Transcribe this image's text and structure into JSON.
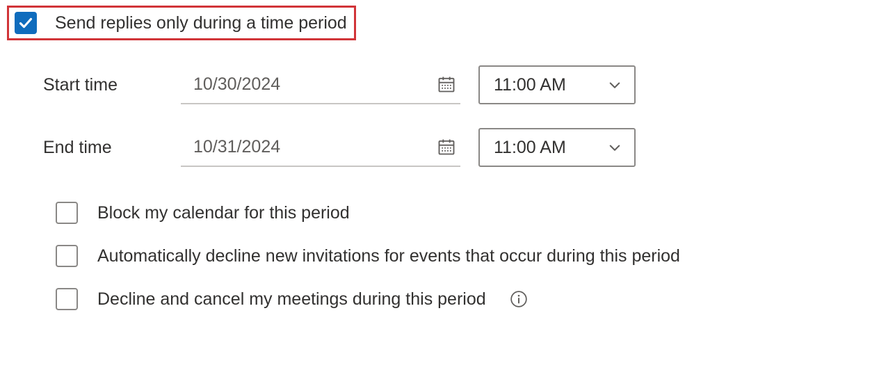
{
  "main": {
    "send_replies_label": "Send replies only during a time period",
    "send_replies_checked": true
  },
  "start": {
    "label": "Start time",
    "date": "10/30/2024",
    "time": "11:00 AM"
  },
  "end": {
    "label": "End time",
    "date": "10/31/2024",
    "time": "11:00 AM"
  },
  "options": {
    "block_calendar": {
      "label": "Block my calendar for this period",
      "checked": false
    },
    "auto_decline": {
      "label": "Automatically decline new invitations for events that occur during this period",
      "checked": false
    },
    "decline_cancel": {
      "label": "Decline and cancel my meetings during this period",
      "checked": false
    }
  }
}
